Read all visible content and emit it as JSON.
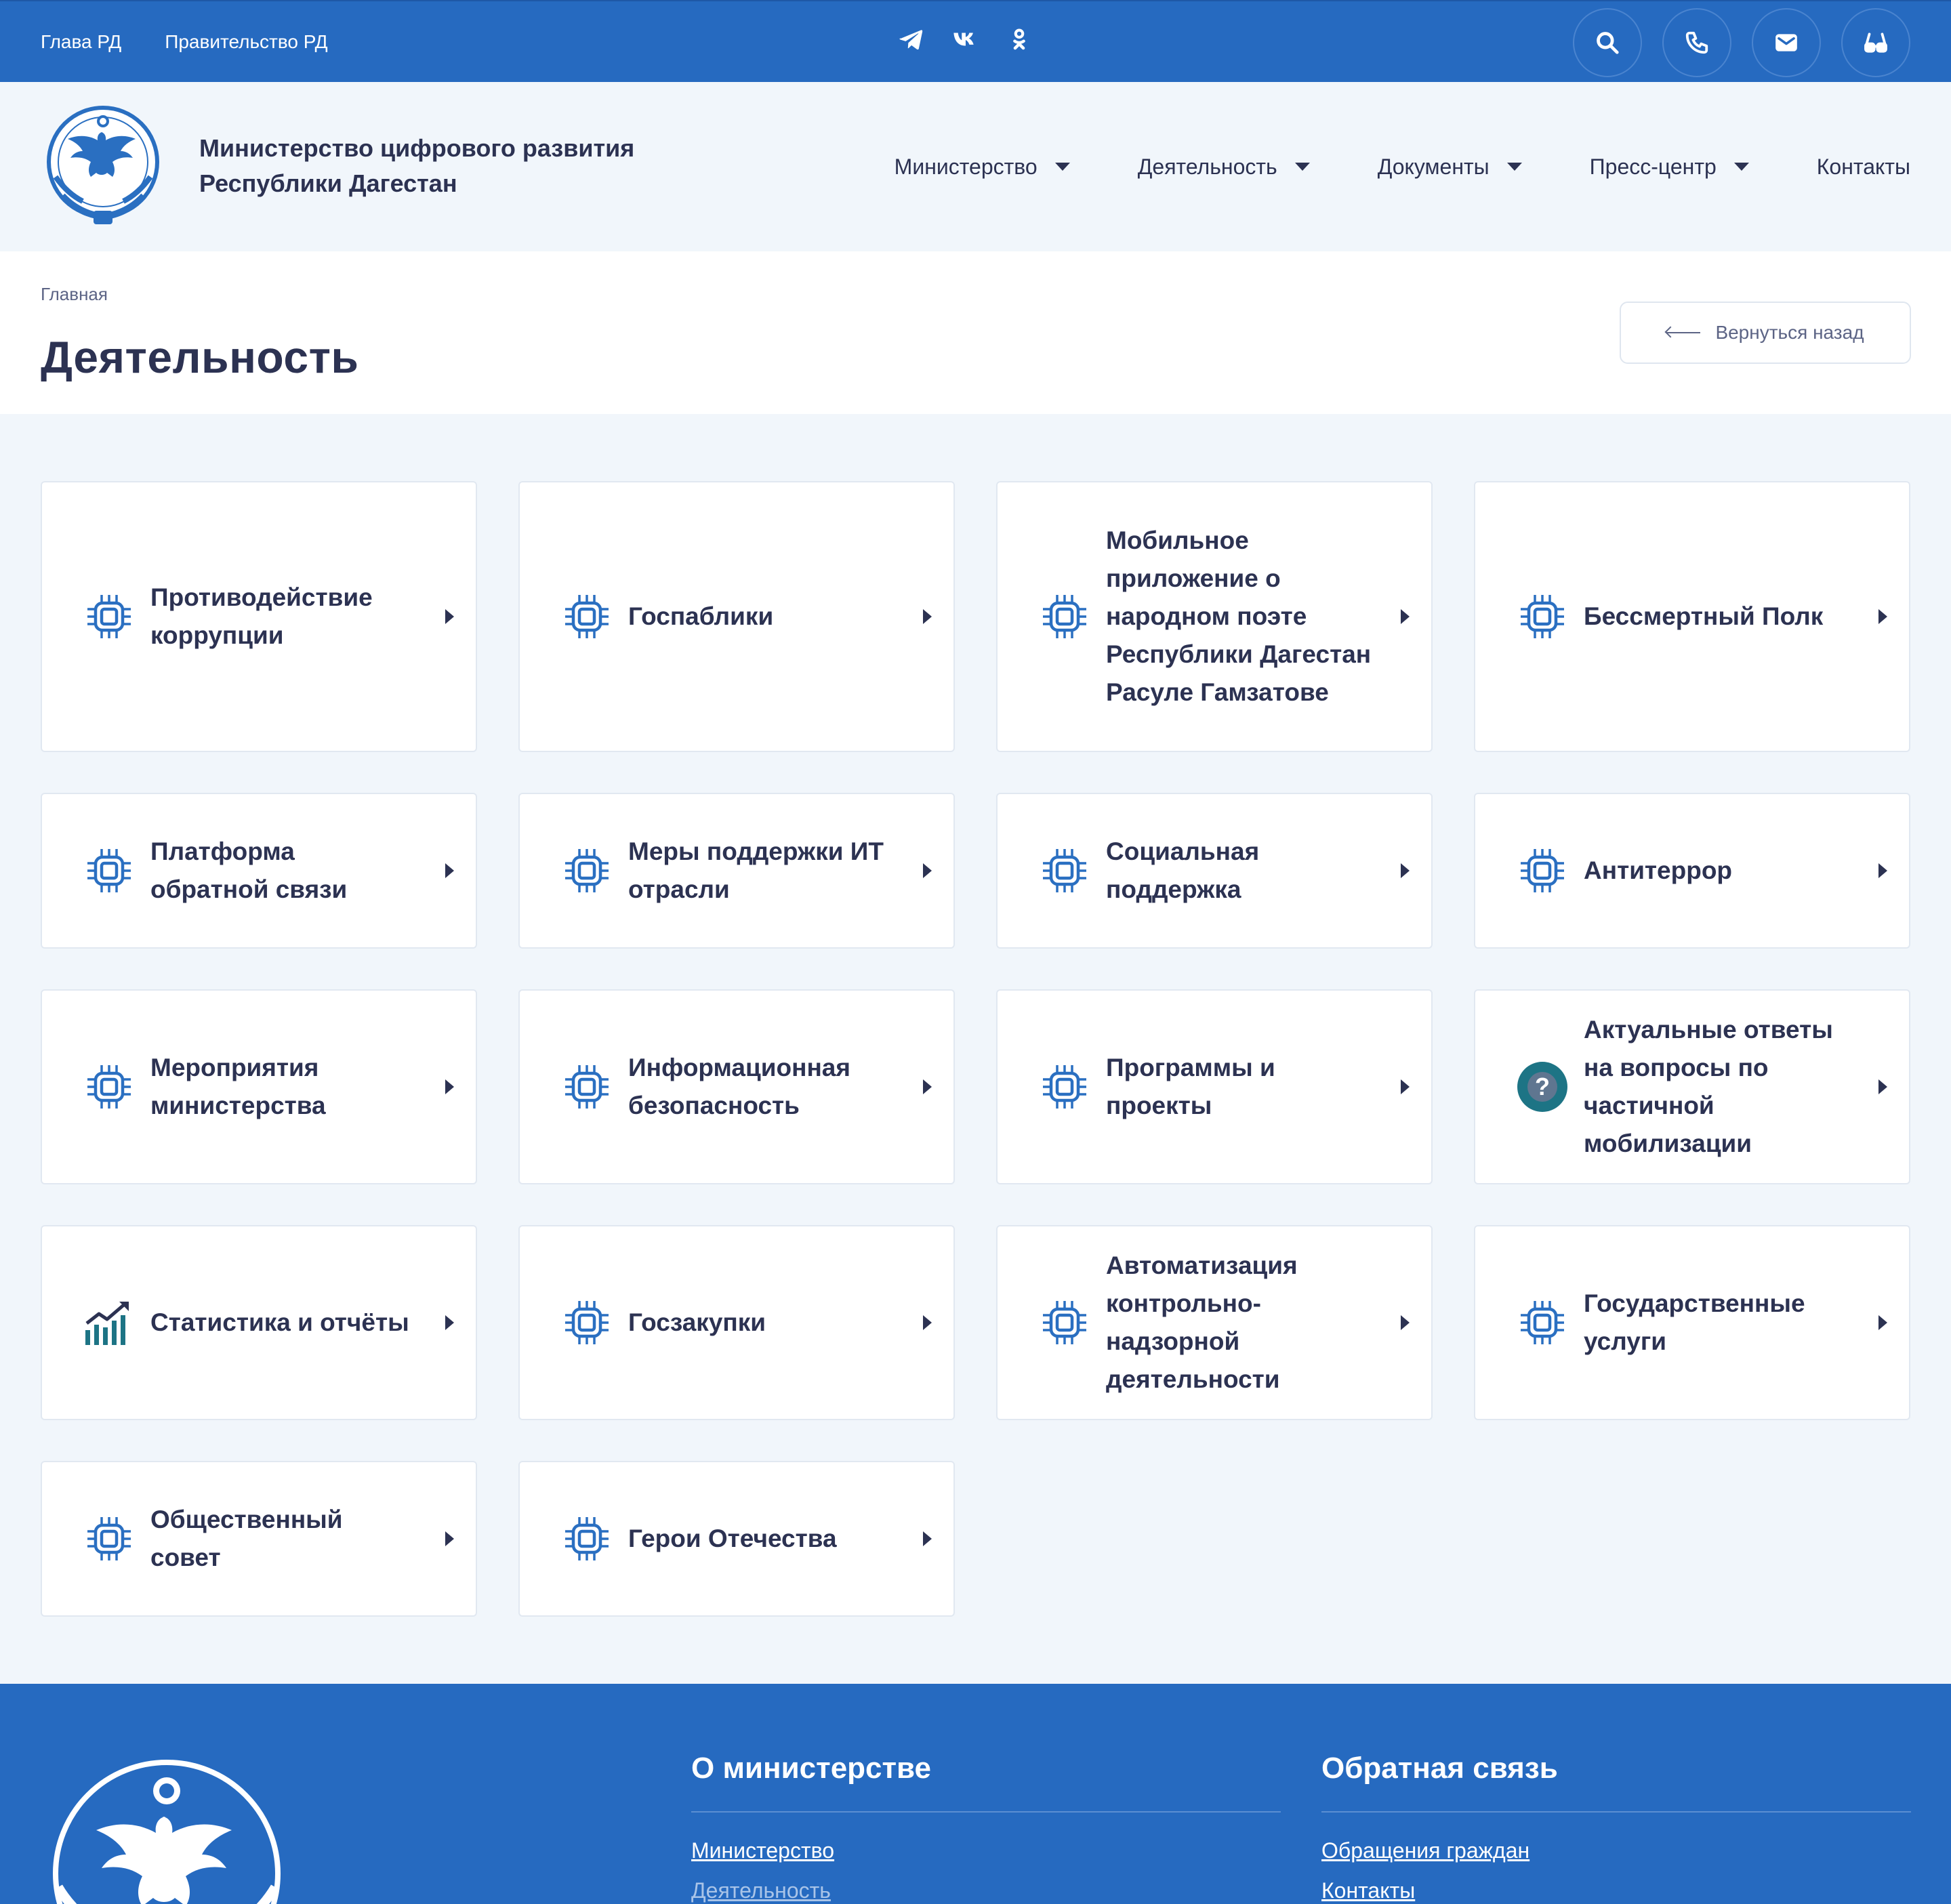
{
  "topbar": {
    "links": [
      "Глава РД",
      "Правительство РД"
    ],
    "social": [
      "telegram-icon",
      "vk-icon",
      "odnoklassniki-icon"
    ],
    "buttons": [
      "search-icon",
      "phone-icon",
      "mail-icon",
      "glasses-icon"
    ]
  },
  "header": {
    "org_line1": "Министерство цифрового развития",
    "org_line2": "Республики Дагестан",
    "nav": [
      "Министерство",
      "Деятельность",
      "Документы",
      "Пресс-центр",
      "Контакты"
    ]
  },
  "page": {
    "breadcrumb": "Главная",
    "title": "Деятельность",
    "back_label": "Вернуться назад"
  },
  "cards": [
    {
      "label": "Противодействие коррупции",
      "icon": "chip-icon"
    },
    {
      "label": "Госпаблики",
      "icon": "chip-icon"
    },
    {
      "label": "Мобильное приложение о народном поэте Республики Дагестан Расуле Гамзатове",
      "icon": "chip-icon"
    },
    {
      "label": "Бессмертный Полк",
      "icon": "chip-icon"
    },
    {
      "label": "Платформа обратной связи",
      "icon": "chip-icon"
    },
    {
      "label": "Меры поддержки ИТ отрасли",
      "icon": "chip-icon"
    },
    {
      "label": "Социальная поддержка",
      "icon": "chip-icon"
    },
    {
      "label": "Антитеррор",
      "icon": "chip-icon"
    },
    {
      "label": "Мероприятия министерства",
      "icon": "chip-icon"
    },
    {
      "label": "Информационная безопасность",
      "icon": "chip-icon"
    },
    {
      "label": "Программы и проекты",
      "icon": "chip-icon"
    },
    {
      "label": "Актуальные ответы на вопросы по частичной мобилизации",
      "icon": "question-icon",
      "icon_text": "?"
    },
    {
      "label": "Статистика и отчёты",
      "icon": "chart-growth-icon"
    },
    {
      "label": "Госзакупки",
      "icon": "chip-icon"
    },
    {
      "label": "Автоматизация контрольно-надзорной деятельности",
      "icon": "chip-icon"
    },
    {
      "label": "Государственные услуги",
      "icon": "chip-icon"
    },
    {
      "label": "Общественный совет",
      "icon": "chip-icon"
    },
    {
      "label": "Герои Отечества",
      "icon": "chip-icon"
    }
  ],
  "footer": {
    "col1_title": "О министерстве",
    "col1_links": [
      "Министерство",
      "Деятельность"
    ],
    "col2_title": "Обратная связь",
    "col2_links": [
      "Обращения граждан",
      "Контакты"
    ]
  },
  "colors": {
    "primary": "#266ac0",
    "text": "#2c3252",
    "icon": "#2a6fc1",
    "background": "#f1f6fb"
  }
}
